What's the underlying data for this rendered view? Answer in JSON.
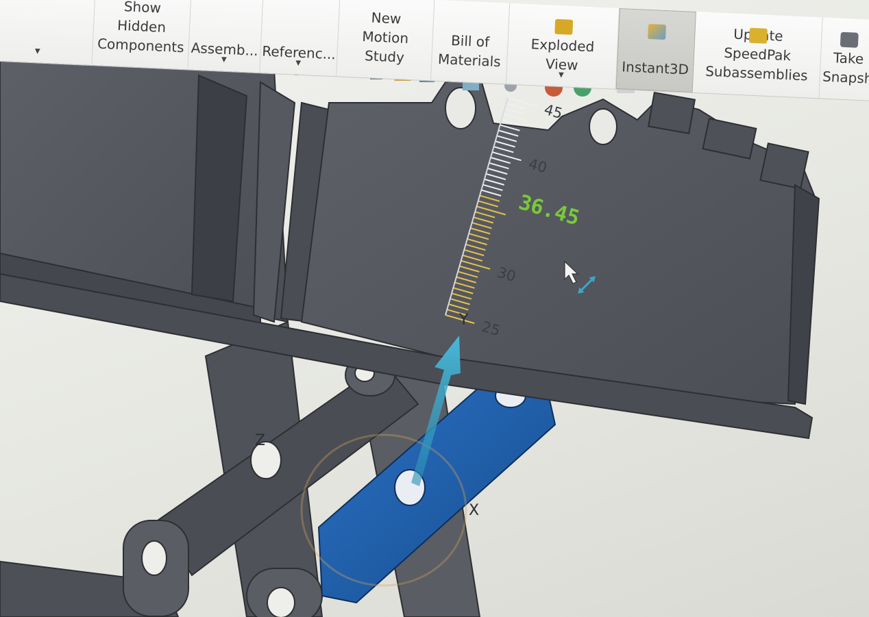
{
  "ribbon": {
    "buttons": [
      {
        "label": "",
        "icon": "dropdown-icon",
        "has_caret": true
      },
      {
        "label": "Show Hidden\nComponents",
        "icon": "show-hidden-icon",
        "has_caret": false
      },
      {
        "label": "Assemb...",
        "icon": "assembly-icon",
        "has_caret": true
      },
      {
        "label": "Referenc...",
        "icon": "reference-icon",
        "has_caret": true
      },
      {
        "label": "New Motion\nStudy",
        "icon": "motion-study-icon",
        "has_caret": false
      },
      {
        "label": "Bill of\nMaterials",
        "icon": "bom-icon",
        "has_caret": false
      },
      {
        "label": "Exploded View",
        "icon": "exploded-view-icon",
        "has_caret": true
      },
      {
        "label": "Instant3D",
        "icon": "instant3d-icon",
        "has_caret": false,
        "active": true
      },
      {
        "label": "Update SpeedPak\nSubassemblies",
        "icon": "speedpak-icon",
        "has_caret": false
      },
      {
        "label": "Take\nSnapsh",
        "icon": "camera-icon",
        "has_caret": false
      }
    ]
  },
  "ruler": {
    "tick_labels": [
      "45",
      "40",
      "30",
      "25"
    ],
    "current_value": "36.45",
    "min": 25,
    "max": 45,
    "highlight_color": "#e6c24a",
    "value_color": "#7ac93a"
  },
  "triad": {
    "y_label": "Y",
    "x_label": "X",
    "z_label": "Z"
  },
  "colors": {
    "model": "#55585f",
    "model_dark": "#3e4148",
    "selected_part": "#1f5fa8",
    "arrow": "#3aa7c9"
  }
}
